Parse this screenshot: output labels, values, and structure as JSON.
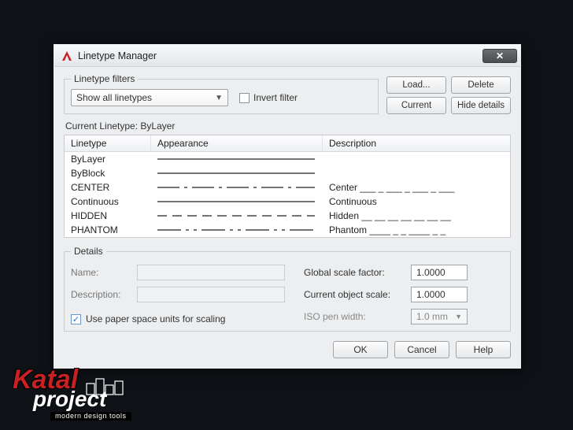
{
  "window": {
    "title": "Linetype Manager"
  },
  "filters": {
    "legend": "Linetype filters",
    "selected": "Show all linetypes",
    "invert_label": "Invert filter"
  },
  "buttons": {
    "load": "Load...",
    "delete": "Delete",
    "current": "Current",
    "hide_details": "Hide details",
    "ok": "OK",
    "cancel": "Cancel",
    "help": "Help"
  },
  "current_linetype_label": "Current Linetype:",
  "current_linetype_value": "ByLayer",
  "list": {
    "headers": {
      "linetype": "Linetype",
      "appearance": "Appearance",
      "description": "Description"
    },
    "rows": [
      {
        "name": "ByLayer",
        "pattern": "solid",
        "desc": ""
      },
      {
        "name": "ByBlock",
        "pattern": "solid",
        "desc": ""
      },
      {
        "name": "CENTER",
        "pattern": "center",
        "desc": "Center ___ _ ___ _ ___ _ ___"
      },
      {
        "name": "Continuous",
        "pattern": "solid",
        "desc": "Continuous"
      },
      {
        "name": "HIDDEN",
        "pattern": "hidden",
        "desc": "Hidden __ __ __ __ __ __ __"
      },
      {
        "name": "PHANTOM",
        "pattern": "phantom",
        "desc": "Phantom ____ _ _ ____ _ _"
      }
    ]
  },
  "details": {
    "legend": "Details",
    "name_label": "Name:",
    "desc_label": "Description:",
    "use_paper_label": "Use paper space units for scaling",
    "global_label": "Global scale factor:",
    "global_value": "1.0000",
    "obj_label": "Current object scale:",
    "obj_value": "1.0000",
    "iso_label": "ISO pen width:",
    "iso_value": "1.0 mm"
  },
  "watermark": {
    "line1": "Katal",
    "line2": "project",
    "tag": "modern design tools"
  }
}
